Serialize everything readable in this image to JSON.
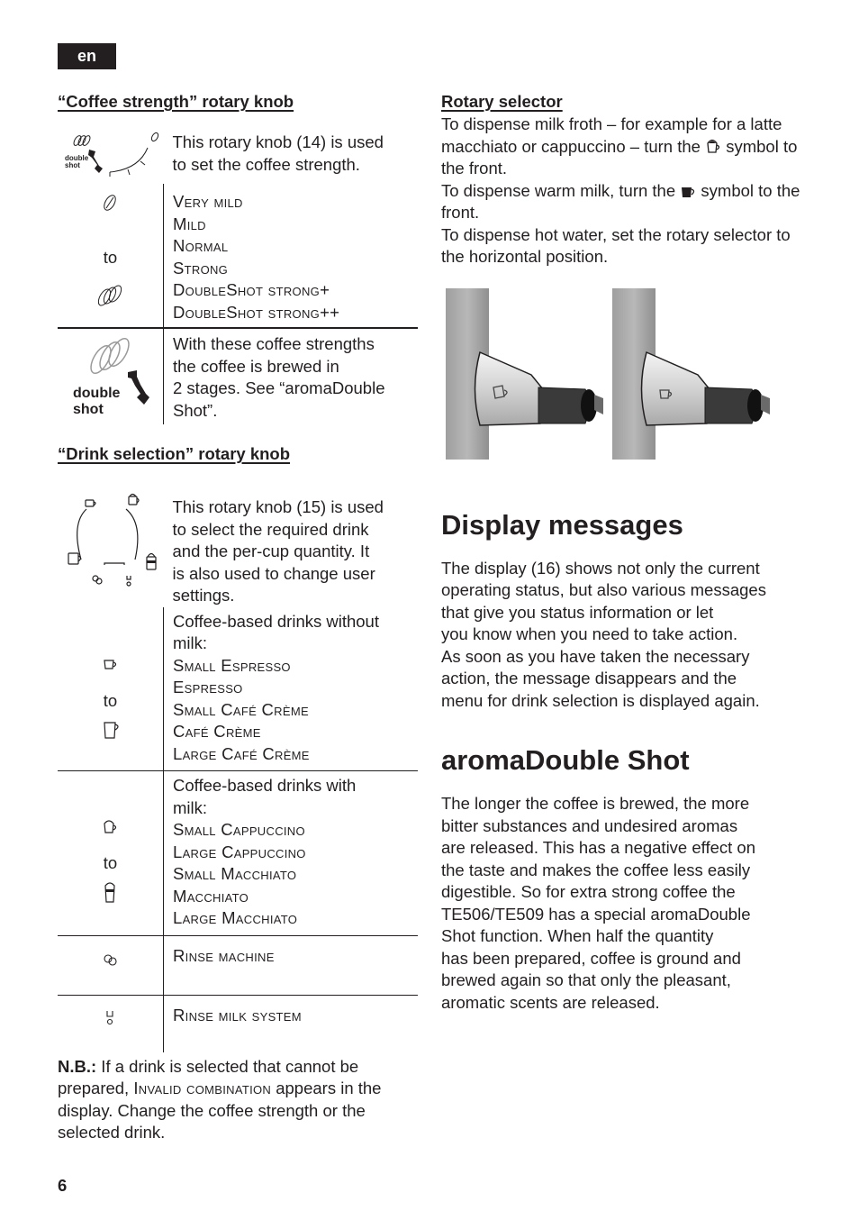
{
  "header": {
    "language_tab": "en"
  },
  "coffee_strength": {
    "heading": "“Coffee strength” rotary knob",
    "intro": [
      "This rotary knob (14) is used",
      "to set the coffee strength."
    ],
    "range_icon_top": "single-bean-icon",
    "range_to": "to",
    "range_icon_bottom": "triple-bean-icon",
    "levels": [
      "Very mild",
      "Mild",
      "Normal",
      "Strong",
      "DoubleShot strong+",
      "DoubleShot strong++"
    ],
    "double_shot_label_1": "double",
    "double_shot_label_2": "shot",
    "double_shot_note": [
      "With these coffee strengths",
      "the coffee is brewed in",
      "2 stages. See “aromaDouble",
      "Shot”."
    ]
  },
  "drink_selection": {
    "heading": "“Drink selection” rotary knob",
    "intro": [
      "This rotary knob (15) is used",
      "to select the required drink",
      "and the per-cup quantity. It",
      "is also used to change user",
      "settings."
    ],
    "groups": [
      {
        "title": [
          "Coffee-based drinks without",
          "milk:"
        ],
        "icon_top": "small-cup-icon",
        "to": "to",
        "icon_bottom": "large-cup-icon",
        "items": [
          "Small Espresso",
          "Espresso",
          "Small Café Crème",
          "Café Crème",
          "Large Café Crème"
        ]
      },
      {
        "title": [
          "Coffee-based drinks with",
          "milk:"
        ],
        "icon_top": "cappuccino-cup-icon",
        "to": "to",
        "icon_bottom": "macchiato-glass-icon",
        "items": [
          "Small Cappuccino",
          "Large Cappuccino",
          "Small Macchiato",
          "Macchiato",
          "Large Macchiato"
        ]
      }
    ],
    "rinse_machine": "Rinse machine",
    "rinse_milk": "Rinse milk system"
  },
  "note": {
    "label": "N.B.:",
    "text_1": " If a drink is selected that cannot be prepared, ",
    "message": "Invalid combination",
    "text_2": " appears in the display. Change the coffee strength or the selected drink."
  },
  "rotary_selector": {
    "heading": "Rotary selector",
    "line_1": "To dispense milk froth – for example for a latte macchiato or cappuccino – turn the",
    "line_1_end": "symbol to the front.",
    "line_2": "To dispense warm milk, turn the",
    "line_2_end": "symbol to the front.",
    "line_3": "To dispense hot water, set the rotary selector to the horizontal position."
  },
  "display_messages": {
    "heading": "Display messages",
    "body": [
      "The display (16) shows not only the current",
      "operating status, but also various messages",
      "that give you status information or let",
      "you know when you need to take action.",
      "As soon as you have taken the necessary",
      "action, the message disappears and the",
      "menu for drink selection is displayed again."
    ]
  },
  "aroma_double_shot": {
    "heading": "aromaDouble Shot",
    "body": [
      "The longer the coffee is brewed, the more",
      "bitter substances and undesired aromas",
      "are released. This has a negative effect on",
      "the taste and makes the coffee less easily",
      "digestible. So for extra strong coffee the",
      "TE506/TE509 has a special aromaDouble",
      "Shot function. When half the quantity",
      "has been prepared, coffee is ground and",
      "brewed again so that only the pleasant,",
      "aromatic scents are released."
    ]
  },
  "footer": {
    "page_number": "6"
  }
}
